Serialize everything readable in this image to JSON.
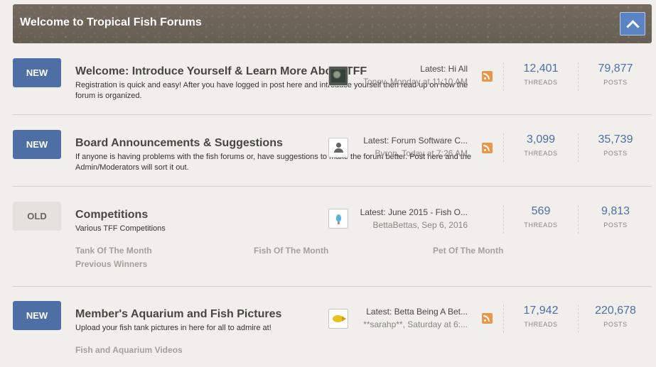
{
  "header": {
    "title": "Welcome to Tropical Fish Forums",
    "collapse_icon": "chevron-up-icon"
  },
  "forums": [
    {
      "badge": "NEW",
      "title": "Welcome: Introduce Yourself & Learn More About TFF",
      "description": "Registration is quick and easy! After you have logged in post here and introduce yourself then read up on how the forum is organized.",
      "latest_label": "Latest:",
      "latest_thread": "Hi All",
      "latest_user": "Tonov",
      "latest_date": "Monday at 11:10 AM",
      "threads": "12,401",
      "posts": "79,877",
      "threads_label": "THREADS",
      "posts_label": "POSTS"
    },
    {
      "badge": "NEW",
      "title": "Board Announcements & Suggestions",
      "description": "If anyone is having problems with the fish forums or, have suggestions to make the forum better. Post here and the Admin/Moderators will sort it out.",
      "latest_label": "Latest:",
      "latest_thread": "Forum Software C...",
      "latest_user": "Byron",
      "latest_date": "Today at 7:26 AM",
      "threads": "3,099",
      "posts": "35,739",
      "threads_label": "THREADS",
      "posts_label": "POSTS"
    },
    {
      "badge": "OLD",
      "title": "Competitions",
      "description": "Various TFF Competitions",
      "latest_label": "Latest:",
      "latest_thread": "June 2015 - Fish O...",
      "latest_user": "BettaBettas,",
      "latest_date": "Sep 6, 2016",
      "threads": "569",
      "posts": "9,813",
      "threads_label": "THREADS",
      "posts_label": "POSTS",
      "subforums": [
        "Tank Of The Month",
        "Fish Of The Month",
        "Pet Of The Month",
        "Previous Winners"
      ]
    },
    {
      "badge": "NEW",
      "title": "Member's Aquarium and Fish Pictures",
      "description": "Upload your fish tank pictures in here for all to admire at!",
      "latest_label": "Latest:",
      "latest_thread": "Betta Being A Bet...",
      "latest_user": "**sarahp**,",
      "latest_date": "Saturday at 6:...",
      "threads": "17,942",
      "posts": "220,678",
      "threads_label": "THREADS",
      "posts_label": "POSTS",
      "subforums": [
        "Fish and Aquarium Videos"
      ]
    }
  ]
}
